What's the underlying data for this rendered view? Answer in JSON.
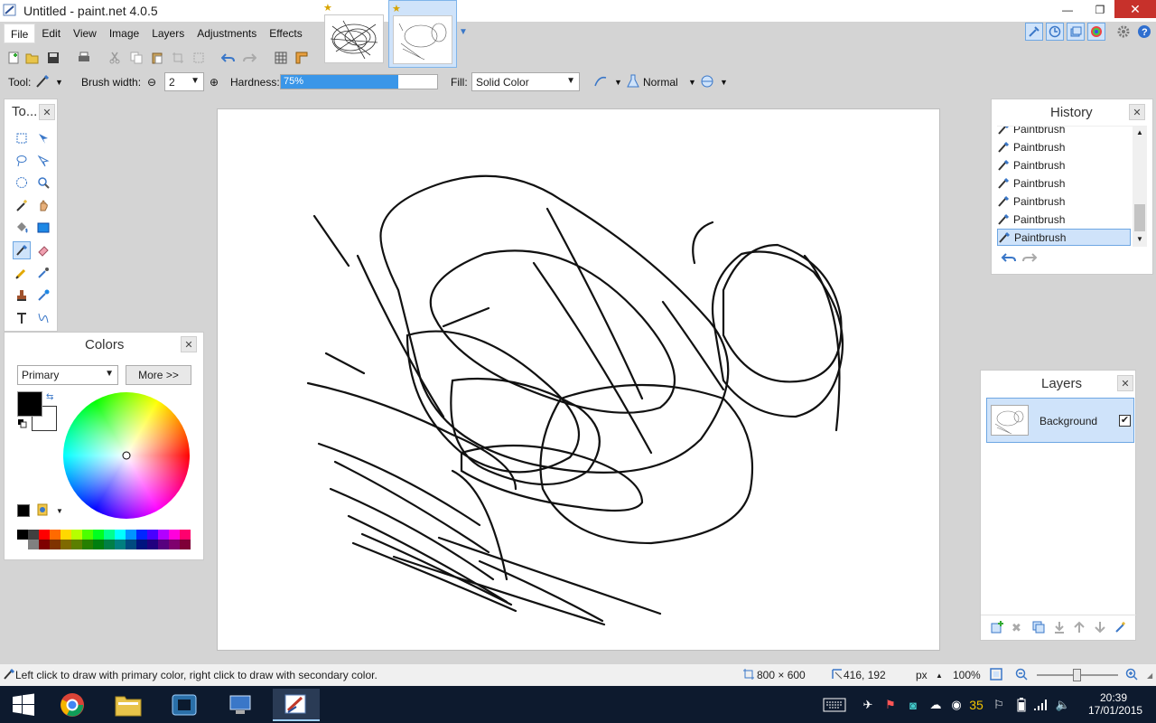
{
  "window": {
    "title": "Untitled - paint.net 4.0.5",
    "minimize": "—",
    "maximize": "❐",
    "close": "✕"
  },
  "menu": [
    "File",
    "Edit",
    "View",
    "Image",
    "Layers",
    "Adjustments",
    "Effects"
  ],
  "toolbar": {
    "tool_label": "Tool:",
    "brush_width_label": "Brush width:",
    "brush_width_value": "2",
    "hardness_label": "Hardness:",
    "hardness_value": "75%",
    "hardness_fraction": 0.75,
    "fill_label": "Fill:",
    "fill_value": "Solid Color",
    "blend_mode": "Normal"
  },
  "panels": {
    "tools_title": "To...",
    "colors_title": "Colors",
    "colors_mode": "Primary",
    "more_button": "More >>",
    "history_title": "History",
    "layers_title": "Layers"
  },
  "history": [
    "Paintbrush",
    "Paintbrush",
    "Paintbrush",
    "Paintbrush",
    "Paintbrush",
    "Paintbrush",
    "Paintbrush"
  ],
  "layers": [
    {
      "name": "Background",
      "visible": true
    }
  ],
  "status": {
    "hint": "Left click to draw with primary color, right click to draw with secondary color.",
    "image_size": "800 × 600",
    "cursor_pos": "416, 192",
    "units": "px",
    "zoom": "100%"
  },
  "taskbar": {
    "time": "20:39",
    "date": "17/01/2015",
    "badge": "35"
  },
  "colors": {
    "accent": "#3a96e8",
    "primary": "#000000",
    "secondary": "#ffffff",
    "palette_top": [
      "#000000",
      "#404040",
      "#ff0000",
      "#ff6a00",
      "#ffd800",
      "#b6ff00",
      "#4cff00",
      "#00ff21",
      "#00ff90",
      "#00ffff",
      "#0094ff",
      "#0026ff",
      "#4800ff",
      "#b200ff",
      "#ff00dc",
      "#ff006e"
    ],
    "palette_bottom": [
      "#ffffff",
      "#808080",
      "#7f0000",
      "#7f3300",
      "#7f6a00",
      "#5b7f00",
      "#267f00",
      "#007f0e",
      "#007f46",
      "#007f7f",
      "#004a7f",
      "#00137f",
      "#21007f",
      "#57007f",
      "#7f006e",
      "#7f0037"
    ]
  }
}
